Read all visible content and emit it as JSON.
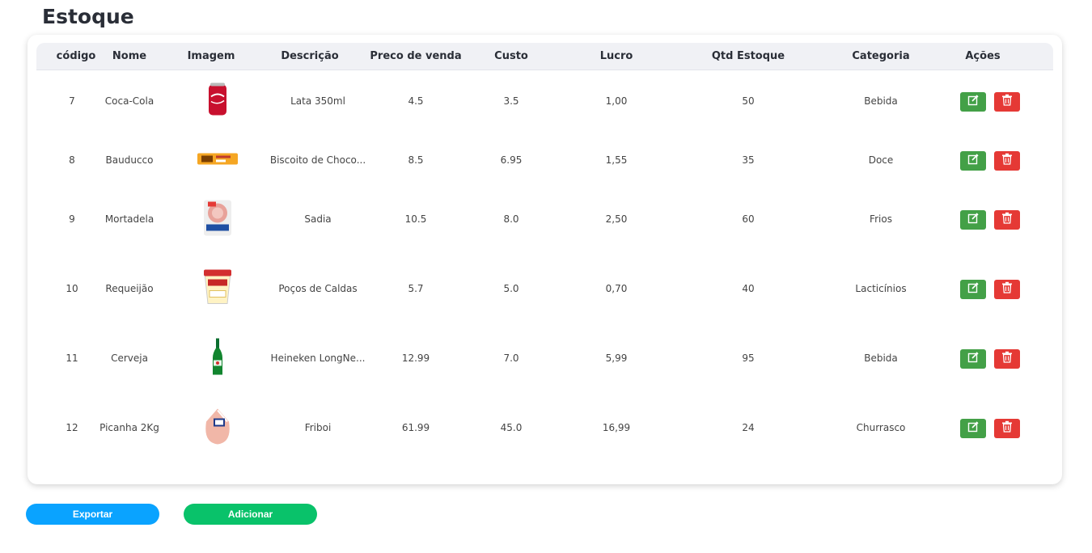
{
  "page": {
    "title": "Estoque"
  },
  "table": {
    "headers": [
      "código",
      "Nome",
      "Imagem",
      "Descrição",
      "Preco de venda",
      "Custo",
      "Lucro",
      "Qtd Estoque",
      "Categoria",
      "Ações"
    ],
    "rows": [
      {
        "codigo": "7",
        "nome": "Coca-Cola",
        "imagem": "coca-cola-can-image",
        "descricao": "Lata 350ml",
        "preco": "4.5",
        "custo": "3.5",
        "lucro": "1,00",
        "qtd": "50",
        "categoria": "Bebida"
      },
      {
        "codigo": "8",
        "nome": "Bauducco",
        "imagem": "bauducco-biscuit-image",
        "descricao": "Biscoito de Choco...",
        "preco": "8.5",
        "custo": "6.95",
        "lucro": "1,55",
        "qtd": "35",
        "categoria": "Doce"
      },
      {
        "codigo": "9",
        "nome": "Mortadela",
        "imagem": "mortadela-package-image",
        "descricao": "Sadia",
        "preco": "10.5",
        "custo": "8.0",
        "lucro": "2,50",
        "qtd": "60",
        "categoria": "Frios"
      },
      {
        "codigo": "10",
        "nome": "Requeijão",
        "imagem": "requeijao-cup-image",
        "descricao": "Poços de Caldas",
        "preco": "5.7",
        "custo": "5.0",
        "lucro": "0,70",
        "qtd": "40",
        "categoria": "Lacticínios"
      },
      {
        "codigo": "11",
        "nome": "Cerveja",
        "imagem": "beer-bottle-image",
        "descricao": "Heineken LongNe...",
        "preco": "12.99",
        "custo": "7.0",
        "lucro": "5,99",
        "qtd": "95",
        "categoria": "Bebida"
      },
      {
        "codigo": "12",
        "nome": "Picanha 2Kg",
        "imagem": "picanha-package-image",
        "descricao": "Friboi",
        "preco": "61.99",
        "custo": "45.0",
        "lucro": "16,99",
        "qtd": "24",
        "categoria": "Churrasco"
      }
    ],
    "actions": {
      "edit_icon": "edit-icon",
      "delete_icon": "trash-icon",
      "edit_color": "#43a047",
      "delete_color": "#e53935"
    }
  },
  "footer": {
    "export_label": "Exportar",
    "add_label": "Adicionar",
    "export_color": "#0aa3ff",
    "add_color": "#09c26a"
  }
}
